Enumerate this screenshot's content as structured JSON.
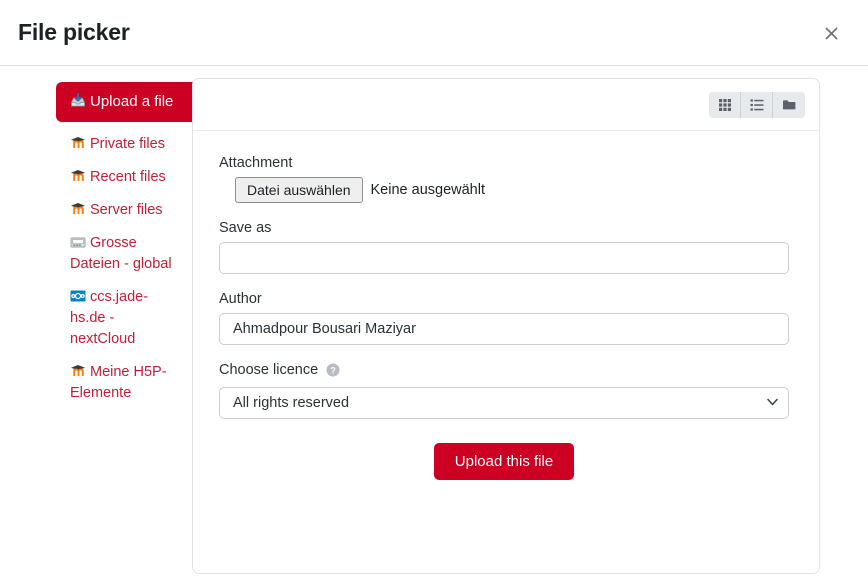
{
  "modal": {
    "title": "File picker",
    "close_label": "×"
  },
  "sidebar": {
    "items": [
      {
        "label": "Upload a file",
        "icon": "upload-tray-icon",
        "active": true
      },
      {
        "label": "Private files",
        "icon": "moodle-m-icon",
        "active": false
      },
      {
        "label": "Recent files",
        "icon": "moodle-m-icon",
        "active": false
      },
      {
        "label": "Server files",
        "icon": "moodle-m-icon",
        "active": false
      },
      {
        "label": "Grosse Dateien - global",
        "icon": "computer-icon",
        "active": false
      },
      {
        "label": "ccs.jade-hs.de - nextCloud",
        "icon": "nextcloud-icon",
        "active": false
      },
      {
        "label": "Meine H5P-Elemente",
        "icon": "moodle-m-icon",
        "active": false
      }
    ]
  },
  "toolbar": {
    "views": [
      {
        "name": "grid-view",
        "icon": "grid-icon",
        "active": false
      },
      {
        "name": "list-view",
        "icon": "list-icon",
        "active": false
      },
      {
        "name": "tree-view",
        "icon": "folder-icon",
        "active": false
      }
    ]
  },
  "form": {
    "attachment": {
      "label": "Attachment",
      "browse_button": "Datei auswählen",
      "status": "Keine ausgewählt"
    },
    "save_as": {
      "label": "Save as",
      "value": "",
      "placeholder": ""
    },
    "author": {
      "label": "Author",
      "value": "Ahmadpour Bousari Maziyar",
      "placeholder": ""
    },
    "licence": {
      "label": "Choose licence",
      "help_icon": "question-mark-icon",
      "selected": "All rights reserved",
      "options": [
        "All rights reserved"
      ]
    },
    "submit": {
      "label": "Upload this file"
    }
  },
  "colors": {
    "brand_red": "#cc0022",
    "link_red": "#c0203a",
    "border_grey": "#dfe3e6",
    "moodle_orange": "#f98012",
    "nextcloud_blue": "#0082c9"
  }
}
